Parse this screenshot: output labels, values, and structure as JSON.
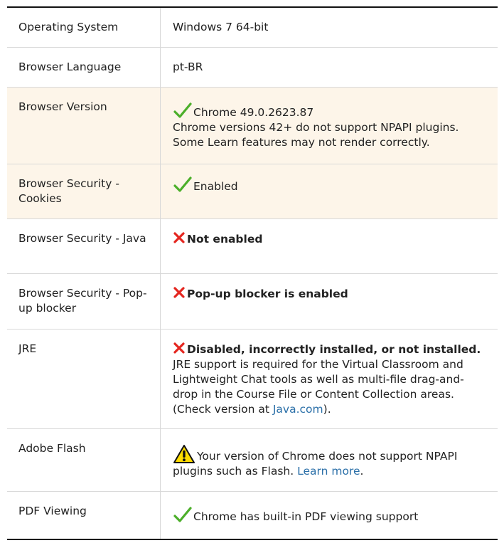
{
  "rows": [
    {
      "label": "Operating System",
      "value": "Windows 7 64-bit"
    },
    {
      "label": "Browser Language",
      "value": "pt-BR"
    },
    {
      "label": "Browser Version",
      "status": "Chrome 49.0.2623.87",
      "note": "Chrome versions 42+ do not support NPAPI plugins. Some Learn features may not render correctly."
    },
    {
      "label": "Browser Security - Cookies",
      "status": "Enabled"
    },
    {
      "label": "Browser Security - Java",
      "status": "Not enabled"
    },
    {
      "label": "Browser Security - Pop-up blocker",
      "status": "Pop-up blocker is enabled"
    },
    {
      "label": "JRE",
      "status": "Disabled, incorrectly installed, or not installed.",
      "note_before": "JRE support is required for the Virtual Classroom and Lightweight Chat tools as well as multi-file drag-and-drop in the Course File or Content Collection areas. (Check version at ",
      "link": "Java.com",
      "note_after": ")."
    },
    {
      "label": "Adobe Flash",
      "status_before": "Your version of Chrome does not support NPAPI plugins such as Flash. ",
      "link": "Learn more",
      "status_after": "."
    },
    {
      "label": "PDF Viewing",
      "status": "Chrome has built-in PDF viewing support"
    }
  ],
  "icons": {
    "ok": "check-icon",
    "error": "x-icon",
    "warning": "warning-icon"
  },
  "colors": {
    "ok": "#4caf2a",
    "error": "#e4261f",
    "warning_fill": "#ffdd00",
    "highlight_row": "#fdf5e9",
    "link": "#2a6fa8"
  }
}
